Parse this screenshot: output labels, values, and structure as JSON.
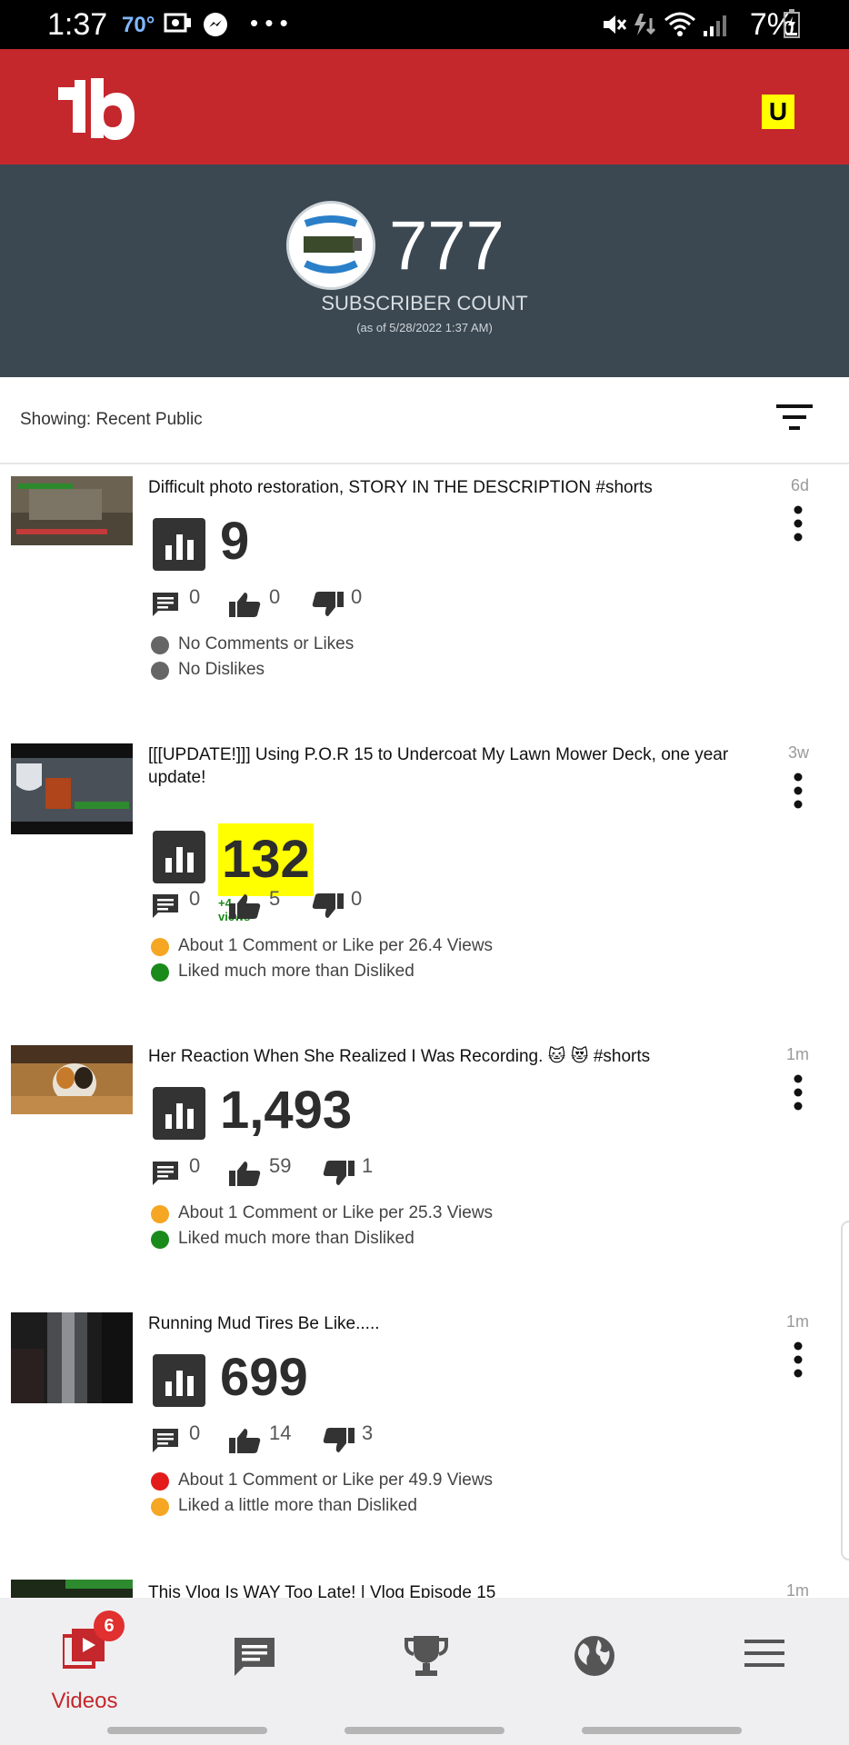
{
  "status_bar": {
    "time": "1:37",
    "temperature": "70°",
    "battery": "7%"
  },
  "header": {
    "user_initial": "U"
  },
  "subscriber_panel": {
    "count": "777",
    "label": "SUBSCRIBER COUNT",
    "as_of": "(as of 5/28/2022 1:37 AM)"
  },
  "filter": {
    "showing": "Showing: Recent Public"
  },
  "videos": [
    {
      "title": "Difficult photo restoration, STORY IN THE DESCRIPTION #shorts",
      "age": "6d",
      "views": "9",
      "comments": "0",
      "likes": "0",
      "dislikes": "0",
      "notes": [
        {
          "color": "#666666",
          "text": "No Comments or Likes"
        },
        {
          "color": "#666666",
          "text": "No Dislikes"
        }
      ]
    },
    {
      "title": "[[[UPDATE!]]] Using P.O.R 15 to Undercoat My Lawn Mower Deck, one year update!",
      "age": "3w",
      "views": "132",
      "views_delta": "+4 views",
      "comments": "0",
      "likes": "5",
      "dislikes": "0",
      "notes": [
        {
          "color": "#f5a623",
          "text": "About 1 Comment or Like per 26.4 Views"
        },
        {
          "color": "#1a8a1a",
          "text": "Liked much more than Disliked"
        }
      ]
    },
    {
      "title": "Her Reaction When She Realized I Was Recording. 🐱 😻 #shorts",
      "age": "1m",
      "views": "1,493",
      "comments": "0",
      "likes": "59",
      "dislikes": "1",
      "notes": [
        {
          "color": "#f5a623",
          "text": "About 1 Comment or Like per 25.3 Views"
        },
        {
          "color": "#1a8a1a",
          "text": "Liked much more than Disliked"
        }
      ]
    },
    {
      "title": "Running Mud Tires Be Like.....",
      "age": "1m",
      "views": "699",
      "comments": "0",
      "likes": "14",
      "dislikes": "3",
      "notes": [
        {
          "color": "#e31b1b",
          "text": "About 1 Comment or Like per 49.9 Views"
        },
        {
          "color": "#f5a623",
          "text": "Liked a little more than Disliked"
        }
      ]
    },
    {
      "title": "This Vlog Is WAY Too Late! | Vlog Episode 15",
      "age": "1m"
    }
  ],
  "bottom_nav": {
    "videos_label": "Videos",
    "videos_badge": "6"
  }
}
